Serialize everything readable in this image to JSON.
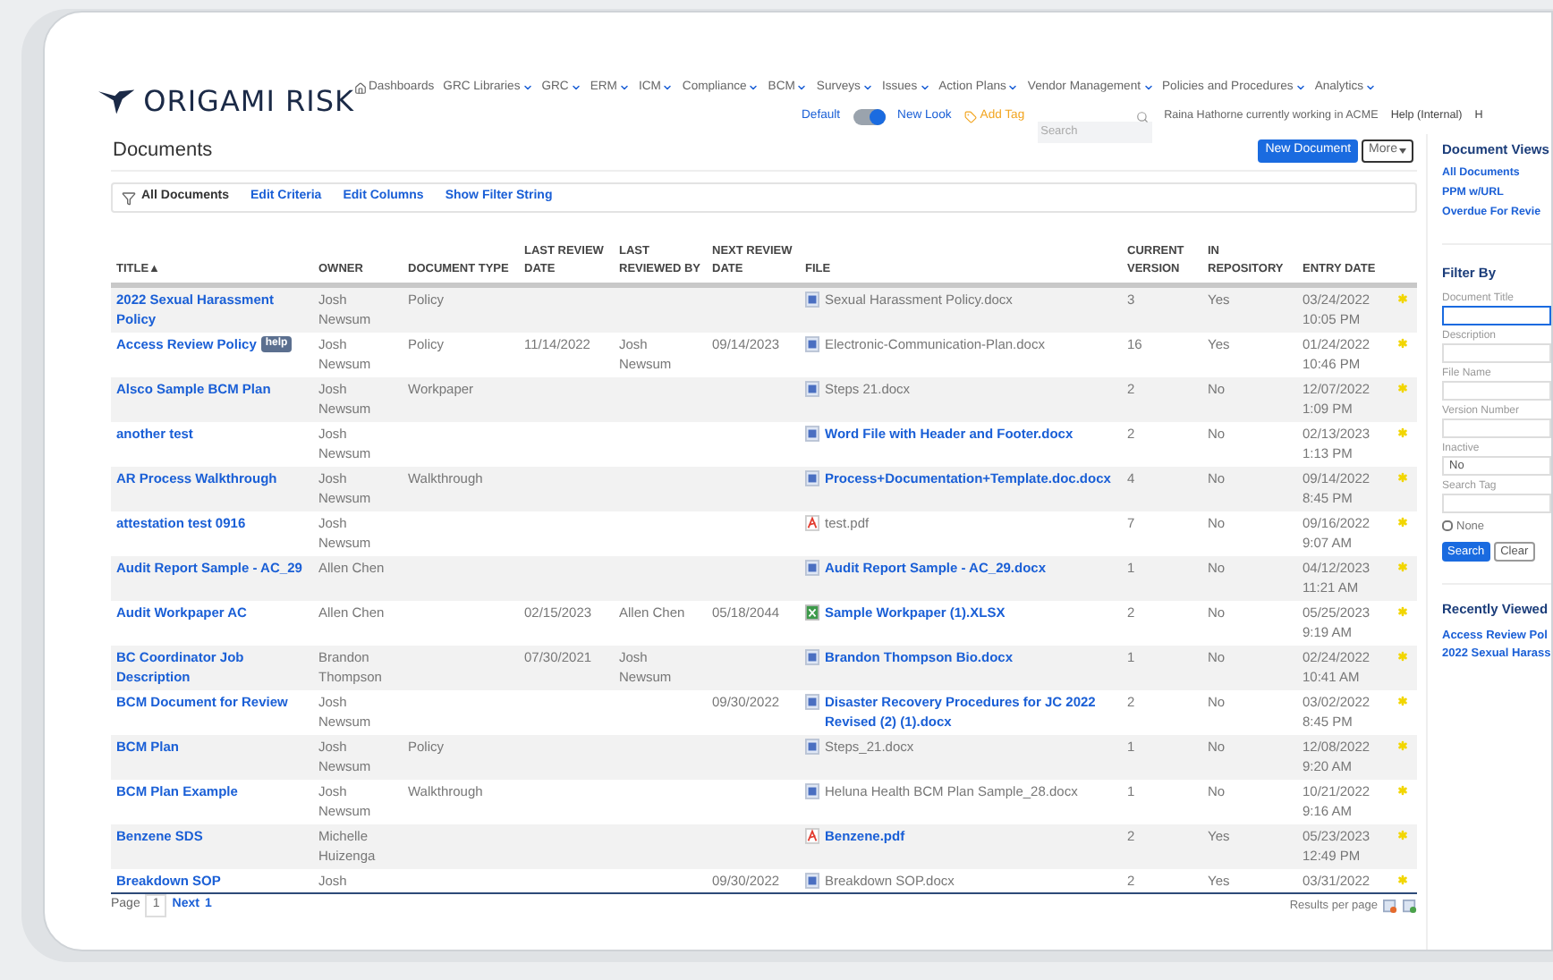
{
  "logo": {
    "text": "ORIGAMI RISK"
  },
  "nav": [
    {
      "label": "Dashboards",
      "kind": "home"
    },
    {
      "label": "GRC Libraries",
      "kind": "menu"
    },
    {
      "label": "GRC",
      "kind": "menu"
    },
    {
      "label": "ERM",
      "kind": "menu"
    },
    {
      "label": "ICM",
      "kind": "menu"
    },
    {
      "label": "Compliance",
      "kind": "menu"
    },
    {
      "label": "BCM",
      "kind": "menu"
    },
    {
      "label": "Surveys",
      "kind": "menu"
    },
    {
      "label": "Issues",
      "kind": "menu"
    },
    {
      "label": "Action Plans",
      "kind": "menu"
    },
    {
      "label": "Vendor Management",
      "kind": "menu"
    },
    {
      "label": "Policies and Procedures",
      "kind": "menu"
    },
    {
      "label": "Analytics",
      "kind": "menu"
    }
  ],
  "utility_bar": {
    "left_label": "Default",
    "toggle_on": true,
    "right_label": "New Look",
    "add_tag": "Add Tag",
    "search": {
      "placeholder": "Search"
    },
    "user_status": "Raina Hathorne currently working in ACME",
    "links": [
      "Help (Internal)",
      "H"
    ]
  },
  "page_title": "Documents",
  "actions": [
    {
      "label": "New Document",
      "kind": "primary"
    },
    {
      "label": "More",
      "kind": "menu"
    }
  ],
  "filter_bar": {
    "current": "All Documents",
    "links": [
      "Edit Criteria",
      "Edit Columns",
      "Show Filter String"
    ]
  },
  "table": {
    "columns": [
      "TITLE▲",
      "OWNER",
      "DOCUMENT TYPE",
      "LAST REVIEW DATE",
      "LAST REVIEWED BY",
      "NEXT REVIEW DATE",
      "FILE",
      "CURRENT VERSION",
      "IN REPOSITORY",
      "ENTRY DATE"
    ],
    "rows": [
      {
        "title": "2022 Sexual Harassment Policy",
        "owner": "Josh Newsum",
        "type": "Policy",
        "file": {
          "kind": "word",
          "name": "Sexual Harassment Policy.docx",
          "linked": false
        },
        "version": "3",
        "repository": "Yes",
        "entry": "03/24/2022 10:05 PM"
      },
      {
        "title": "Access Review Policy",
        "badge": "help",
        "owner": "Josh Newsum",
        "type": "Policy",
        "last_review": "11/14/2022",
        "reviewed_by": "Josh Newsum",
        "next_review": "09/14/2023",
        "file": {
          "kind": "word",
          "name": "Electronic-Communication-Plan.docx",
          "linked": false
        },
        "version": "16",
        "repository": "Yes",
        "entry": "01/24/2022 10:46 PM"
      },
      {
        "title": "Alsco Sample BCM Plan",
        "owner": "Josh Newsum",
        "type": "Workpaper",
        "file": {
          "kind": "word",
          "name": "Steps 21.docx",
          "linked": false
        },
        "version": "2",
        "repository": "No",
        "entry": "12/07/2022 1:09 PM"
      },
      {
        "title": "another test",
        "owner": "Josh Newsum",
        "file": {
          "kind": "word",
          "name": "Word File with Header and Footer.docx",
          "linked": true
        },
        "version": "2",
        "repository": "No",
        "entry": "02/13/2023 1:13 PM"
      },
      {
        "title": "AR Process Walkthrough",
        "owner": "Josh Newsum",
        "type": "Walkthrough",
        "file": {
          "kind": "word",
          "name": "Process+Documentation+Template.doc.docx",
          "linked": true
        },
        "version": "4",
        "repository": "No",
        "entry": "09/14/2022 8:45 PM"
      },
      {
        "title": "attestation test 0916",
        "owner": "Josh Newsum",
        "file": {
          "kind": "pdf",
          "name": "test.pdf",
          "linked": false
        },
        "version": "7",
        "repository": "No",
        "entry": "09/16/2022 9:07 AM"
      },
      {
        "title": "Audit Report Sample - AC_29",
        "owner": "Allen Chen",
        "file": {
          "kind": "word",
          "name": "Audit Report Sample - AC_29.docx",
          "linked": true
        },
        "version": "1",
        "repository": "No",
        "entry": "04/12/2023 11:21 AM"
      },
      {
        "title": "Audit Workpaper AC",
        "owner": "Allen Chen",
        "last_review": "02/15/2023",
        "reviewed_by": "Allen Chen",
        "next_review": "05/18/2044",
        "file": {
          "kind": "excel",
          "name": "Sample Workpaper (1).XLSX",
          "linked": true
        },
        "version": "2",
        "repository": "No",
        "entry": "05/25/2023 9:19 AM"
      },
      {
        "title": "BC Coordinator Job Description",
        "owner": "Brandon Thompson",
        "last_review": "07/30/2021",
        "reviewed_by": "Josh Newsum",
        "file": {
          "kind": "word",
          "name": "Brandon Thompson Bio.docx",
          "linked": true
        },
        "version": "1",
        "repository": "No",
        "entry": "02/24/2022 10:41 AM"
      },
      {
        "title": "BCM Document for Review",
        "owner": "Josh Newsum",
        "next_review": "09/30/2022",
        "file": {
          "kind": "word",
          "name": "Disaster Recovery Procedures for JC 2022 Revised (2) (1).docx",
          "linked": true
        },
        "version": "2",
        "repository": "No",
        "entry": "03/02/2022 8:45 PM"
      },
      {
        "title": "BCM Plan",
        "owner": "Josh Newsum",
        "type": "Policy",
        "file": {
          "kind": "word",
          "name": "Steps_21.docx",
          "linked": false
        },
        "version": "1",
        "repository": "No",
        "entry": "12/08/2022 9:20 AM"
      },
      {
        "title": "BCM Plan Example",
        "owner": "Josh Newsum",
        "type": "Walkthrough",
        "file": {
          "kind": "word",
          "name": "Heluna Health BCM Plan Sample_28.docx",
          "linked": false
        },
        "version": "1",
        "repository": "No",
        "entry": "10/21/2022 9:16 AM"
      },
      {
        "title": "Benzene SDS",
        "owner": "Michelle Huizenga",
        "file": {
          "kind": "pdf",
          "name": "Benzene.pdf",
          "linked": true
        },
        "version": "2",
        "repository": "Yes",
        "entry": "05/23/2023 12:49 PM"
      },
      {
        "title": "Breakdown SOP",
        "owner": "Josh",
        "next_review": "09/30/2022",
        "file": {
          "kind": "word",
          "name": "Breakdown SOP.docx",
          "linked": false
        },
        "version": "2",
        "repository": "Yes",
        "entry": "03/31/2022"
      }
    ]
  },
  "pagination": {
    "label": "Page",
    "page": "1",
    "next": "Next",
    "total": "1",
    "results_label": "Results per page"
  },
  "sidebar": {
    "views_title": "Document Views",
    "views": [
      "All Documents",
      "PPM w/URL",
      "Overdue For Revie"
    ],
    "filter_title": "Filter By",
    "fields": [
      {
        "label": "Document Title",
        "kind": "text"
      },
      {
        "label": "Description",
        "kind": "text"
      },
      {
        "label": "File Name",
        "kind": "text"
      },
      {
        "label": "Version Number",
        "kind": "text"
      },
      {
        "label": "Inactive",
        "kind": "select",
        "value": "No"
      },
      {
        "label": "Search Tag",
        "kind": "text"
      }
    ],
    "none_checkbox": {
      "label": "None",
      "checked": false
    },
    "buttons": [
      {
        "label": "Search",
        "kind": "primary"
      },
      {
        "label": "Clear",
        "kind": "secondary"
      }
    ],
    "recent_title": "Recently Viewed",
    "recent": [
      "Access Review Pol",
      "2022 Sexual Harass"
    ]
  }
}
